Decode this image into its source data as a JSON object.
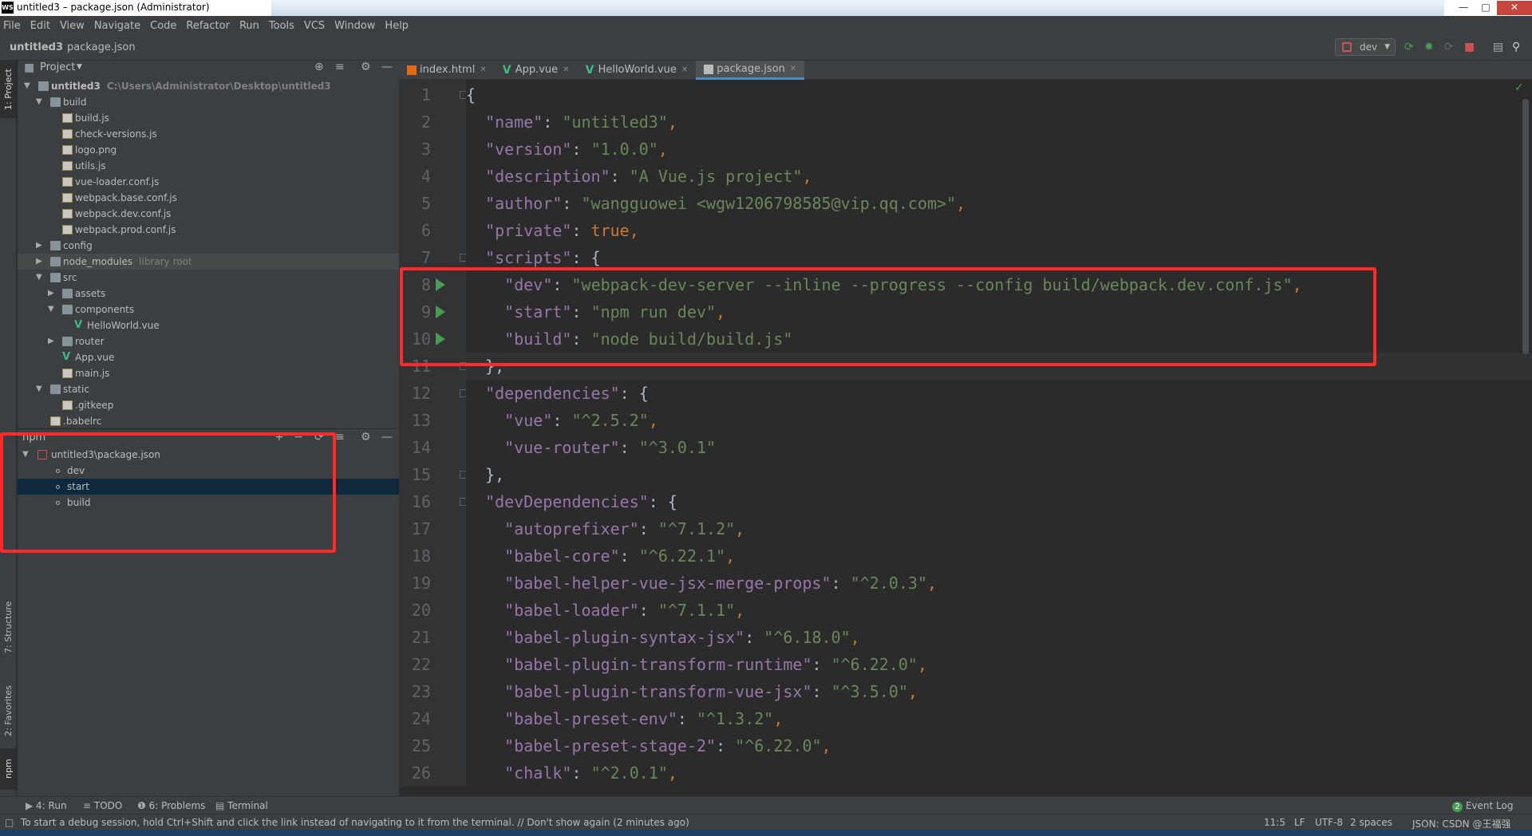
{
  "window": {
    "title": "untitled3 – package.json (Administrator)",
    "logo_text": "WS"
  },
  "menu": [
    "File",
    "Edit",
    "View",
    "Navigate",
    "Code",
    "Refactor",
    "Run",
    "Tools",
    "VCS",
    "Window",
    "Help"
  ],
  "breadcrumb": {
    "project": "untitled3",
    "file": "package.json"
  },
  "run_config": {
    "name": "dev"
  },
  "left_strip": {
    "project": "1: Project",
    "structure": "7: Structure",
    "favorites": "2: Favorites",
    "npm": "npm"
  },
  "project_panel": {
    "title": "Project",
    "rows": [
      {
        "label": "untitled3",
        "extra": "C:\\Users\\Administrator\\Desktop\\untitled3",
        "depth": 0,
        "arrow": "down",
        "icon": "folder",
        "bold": true
      },
      {
        "label": "build",
        "depth": 1,
        "arrow": "down",
        "icon": "folder"
      },
      {
        "label": "build.js",
        "depth": 2,
        "icon": "file-js"
      },
      {
        "label": "check-versions.js",
        "depth": 2,
        "icon": "file-js"
      },
      {
        "label": "logo.png",
        "depth": 2,
        "icon": "file-js"
      },
      {
        "label": "utils.js",
        "depth": 2,
        "icon": "file-js"
      },
      {
        "label": "vue-loader.conf.js",
        "depth": 2,
        "icon": "file-js"
      },
      {
        "label": "webpack.base.conf.js",
        "depth": 2,
        "icon": "file-js"
      },
      {
        "label": "webpack.dev.conf.js",
        "depth": 2,
        "icon": "file-js"
      },
      {
        "label": "webpack.prod.conf.js",
        "depth": 2,
        "icon": "file-js"
      },
      {
        "label": "config",
        "depth": 1,
        "arrow": "right",
        "icon": "folder"
      },
      {
        "label": "node_modules",
        "extra": "library root",
        "depth": 1,
        "arrow": "right",
        "icon": "folder",
        "highlight": true
      },
      {
        "label": "src",
        "depth": 1,
        "arrow": "down",
        "icon": "folder"
      },
      {
        "label": "assets",
        "depth": 2,
        "arrow": "right",
        "icon": "folder"
      },
      {
        "label": "components",
        "depth": 2,
        "arrow": "down",
        "icon": "folder"
      },
      {
        "label": "HelloWorld.vue",
        "depth": 3,
        "icon": "vue"
      },
      {
        "label": "router",
        "depth": 2,
        "arrow": "right",
        "icon": "folder"
      },
      {
        "label": "App.vue",
        "depth": 2,
        "icon": "vue"
      },
      {
        "label": "main.js",
        "depth": 2,
        "icon": "file-js"
      },
      {
        "label": "static",
        "depth": 1,
        "arrow": "down",
        "icon": "folder"
      },
      {
        "label": ".gitkeep",
        "depth": 2,
        "icon": "file-js"
      },
      {
        "label": ".babelrc",
        "depth": 1,
        "icon": "file-js"
      }
    ]
  },
  "npm_panel": {
    "title": "npm",
    "package": "untitled3\\package.json",
    "scripts": [
      {
        "label": "dev"
      },
      {
        "label": "start",
        "selected": true
      },
      {
        "label": "build"
      }
    ]
  },
  "tabs": [
    {
      "label": "index.html",
      "icon": "html"
    },
    {
      "label": "App.vue",
      "icon": "vue"
    },
    {
      "label": "HelloWorld.vue",
      "icon": "vue"
    },
    {
      "label": "package.json",
      "icon": "json",
      "active": true
    }
  ],
  "code_lines": [
    {
      "n": "1",
      "t": [
        [
          "b",
          "{"
        ]
      ]
    },
    {
      "n": "2",
      "t": [
        [
          "b",
          "  "
        ],
        [
          "k",
          "\"name\""
        ],
        [
          "b",
          ": "
        ],
        [
          "s",
          "\"untitled3\""
        ],
        [
          "p",
          ","
        ]
      ]
    },
    {
      "n": "3",
      "t": [
        [
          "b",
          "  "
        ],
        [
          "k",
          "\"version\""
        ],
        [
          "b",
          ": "
        ],
        [
          "s",
          "\"1.0.0\""
        ],
        [
          "p",
          ","
        ]
      ]
    },
    {
      "n": "4",
      "t": [
        [
          "b",
          "  "
        ],
        [
          "k",
          "\"description\""
        ],
        [
          "b",
          ": "
        ],
        [
          "s",
          "\"A Vue.js project\""
        ],
        [
          "p",
          ","
        ]
      ]
    },
    {
      "n": "5",
      "t": [
        [
          "b",
          "  "
        ],
        [
          "k",
          "\"author\""
        ],
        [
          "b",
          ": "
        ],
        [
          "s",
          "\"wangguowei <wgw1206798585@vip.qq.com>\""
        ],
        [
          "p",
          ","
        ]
      ]
    },
    {
      "n": "6",
      "t": [
        [
          "b",
          "  "
        ],
        [
          "k",
          "\"private\""
        ],
        [
          "b",
          ": "
        ],
        [
          "kw",
          "true"
        ],
        [
          "p",
          ","
        ]
      ]
    },
    {
      "n": "7",
      "t": [
        [
          "b",
          "  "
        ],
        [
          "k",
          "\"scripts\""
        ],
        [
          "b",
          ": {"
        ]
      ]
    },
    {
      "n": "8",
      "run": true,
      "t": [
        [
          "b",
          "    "
        ],
        [
          "k",
          "\"dev\""
        ],
        [
          "b",
          ": "
        ],
        [
          "s",
          "\"webpack-dev-server --inline --progress --config build/webpack.dev.conf.js\""
        ],
        [
          "p",
          ","
        ]
      ]
    },
    {
      "n": "9",
      "run": true,
      "t": [
        [
          "b",
          "    "
        ],
        [
          "k",
          "\"start\""
        ],
        [
          "b",
          ": "
        ],
        [
          "s",
          "\"npm run dev\""
        ],
        [
          "p",
          ","
        ]
      ]
    },
    {
      "n": "10",
      "run": true,
      "t": [
        [
          "b",
          "    "
        ],
        [
          "k",
          "\"build\""
        ],
        [
          "b",
          ": "
        ],
        [
          "s",
          "\"node build/build.js\""
        ]
      ]
    },
    {
      "n": "11",
      "cur": true,
      "t": [
        [
          "b",
          "  },"
        ]
      ]
    },
    {
      "n": "12",
      "t": [
        [
          "b",
          "  "
        ],
        [
          "k",
          "\"dependencies\""
        ],
        [
          "b",
          ": {"
        ]
      ]
    },
    {
      "n": "13",
      "t": [
        [
          "b",
          "    "
        ],
        [
          "k",
          "\"vue\""
        ],
        [
          "b",
          ": "
        ],
        [
          "s",
          "\"^2.5.2\""
        ],
        [
          "p",
          ","
        ]
      ]
    },
    {
      "n": "14",
      "t": [
        [
          "b",
          "    "
        ],
        [
          "k",
          "\"vue-router\""
        ],
        [
          "b",
          ": "
        ],
        [
          "s",
          "\"^3.0.1\""
        ]
      ]
    },
    {
      "n": "15",
      "t": [
        [
          "b",
          "  },"
        ]
      ]
    },
    {
      "n": "16",
      "t": [
        [
          "b",
          "  "
        ],
        [
          "k",
          "\"devDependencies\""
        ],
        [
          "b",
          ": {"
        ]
      ]
    },
    {
      "n": "17",
      "t": [
        [
          "b",
          "    "
        ],
        [
          "k",
          "\"autoprefixer\""
        ],
        [
          "b",
          ": "
        ],
        [
          "s",
          "\"^7.1.2\""
        ],
        [
          "p",
          ","
        ]
      ]
    },
    {
      "n": "18",
      "t": [
        [
          "b",
          "    "
        ],
        [
          "k",
          "\"babel-core\""
        ],
        [
          "b",
          ": "
        ],
        [
          "s",
          "\"^6.22.1\""
        ],
        [
          "p",
          ","
        ]
      ]
    },
    {
      "n": "19",
      "t": [
        [
          "b",
          "    "
        ],
        [
          "k",
          "\"babel-helper-vue-jsx-merge-props\""
        ],
        [
          "b",
          ": "
        ],
        [
          "s",
          "\"^2.0.3\""
        ],
        [
          "p",
          ","
        ]
      ]
    },
    {
      "n": "20",
      "t": [
        [
          "b",
          "    "
        ],
        [
          "k",
          "\"babel-loader\""
        ],
        [
          "b",
          ": "
        ],
        [
          "s",
          "\"^7.1.1\""
        ],
        [
          "p",
          ","
        ]
      ]
    },
    {
      "n": "21",
      "t": [
        [
          "b",
          "    "
        ],
        [
          "k",
          "\"babel-plugin-syntax-jsx\""
        ],
        [
          "b",
          ": "
        ],
        [
          "s",
          "\"^6.18.0\""
        ],
        [
          "p",
          ","
        ]
      ]
    },
    {
      "n": "22",
      "t": [
        [
          "b",
          "    "
        ],
        [
          "k",
          "\"babel-plugin-transform-runtime\""
        ],
        [
          "b",
          ": "
        ],
        [
          "s",
          "\"^6.22.0\""
        ],
        [
          "p",
          ","
        ]
      ]
    },
    {
      "n": "23",
      "t": [
        [
          "b",
          "    "
        ],
        [
          "k",
          "\"babel-plugin-transform-vue-jsx\""
        ],
        [
          "b",
          ": "
        ],
        [
          "s",
          "\"^3.5.0\""
        ],
        [
          "p",
          ","
        ]
      ]
    },
    {
      "n": "24",
      "t": [
        [
          "b",
          "    "
        ],
        [
          "k",
          "\"babel-preset-env\""
        ],
        [
          "b",
          ": "
        ],
        [
          "s",
          "\"^1.3.2\""
        ],
        [
          "p",
          ","
        ]
      ]
    },
    {
      "n": "25",
      "t": [
        [
          "b",
          "    "
        ],
        [
          "k",
          "\"babel-preset-stage-2\""
        ],
        [
          "b",
          ": "
        ],
        [
          "s",
          "\"^6.22.0\""
        ],
        [
          "p",
          ","
        ]
      ]
    },
    {
      "n": "26",
      "t": [
        [
          "b",
          "    "
        ],
        [
          "k",
          "\"chalk\""
        ],
        [
          "b",
          ": "
        ],
        [
          "s",
          "\"^2.0.1\""
        ],
        [
          "p",
          ","
        ]
      ]
    }
  ],
  "bottom_tabs": {
    "run": "4: Run",
    "todo": "TODO",
    "problems": "6: Problems",
    "terminal": "Terminal",
    "event_log": "Event Log",
    "event_count": "2"
  },
  "status": {
    "message": "To start a debug session, hold Ctrl+Shift and click the link instead of navigating to it from the terminal. // Don't show again (2 minutes ago)",
    "position": "11:5",
    "line_sep": "LF",
    "encoding": "UTF-8",
    "indent": "2 spaces",
    "schema": "JSON: CSDN @王福强"
  }
}
